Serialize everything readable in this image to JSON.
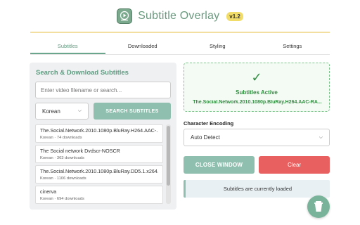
{
  "app": {
    "title": "Subtitle Overlay",
    "version": "v1.2",
    "logo_icon": "play-subtitle-icon"
  },
  "tabs": [
    {
      "label": "Subtitles",
      "active": true
    },
    {
      "label": "Downloaded",
      "active": false
    },
    {
      "label": "Styling",
      "active": false
    },
    {
      "label": "Settings",
      "active": false
    }
  ],
  "search": {
    "title": "Search & Download Subtitles",
    "placeholder": "Enter video filename or search...",
    "value": "",
    "language": "Korean",
    "button_label": "SEARCH SUBTITLES"
  },
  "results": [
    {
      "name": "The.Social.Network.2010.1080p.BluRay.H264.AAC-...",
      "meta": "Korean · 74 downloads"
    },
    {
      "name": "The Social network Dvdscr-NOSCR",
      "meta": "Korean · 363 downloads"
    },
    {
      "name": "The.Social.Network.2010.1080p.BluRay.DD5.1.x264...",
      "meta": "Korean · 1106 downloads"
    },
    {
      "name": "cinerva",
      "meta": "Korean · 694 downloads"
    }
  ],
  "status": {
    "icon": "check-icon",
    "check_glyph": "✓",
    "title": "Subtitles Active",
    "file": "The.Social.Network.2010.1080p.BluRay.H264.AAC-RA..."
  },
  "encoding": {
    "label": "Character Encoding",
    "value": "Auto Detect"
  },
  "actions": {
    "close_label": "CLOSE WINDOW",
    "clear_label": "Clear"
  },
  "loaded_message": "Subtitles are currently loaded",
  "colors": {
    "accent": "#8fbfae",
    "brand": "#6a9a7f",
    "danger": "#e8605f",
    "success": "#2f8f3e",
    "version_badge": "#f1dc6a"
  },
  "floating": {
    "icon": "coffee-cup-icon"
  }
}
